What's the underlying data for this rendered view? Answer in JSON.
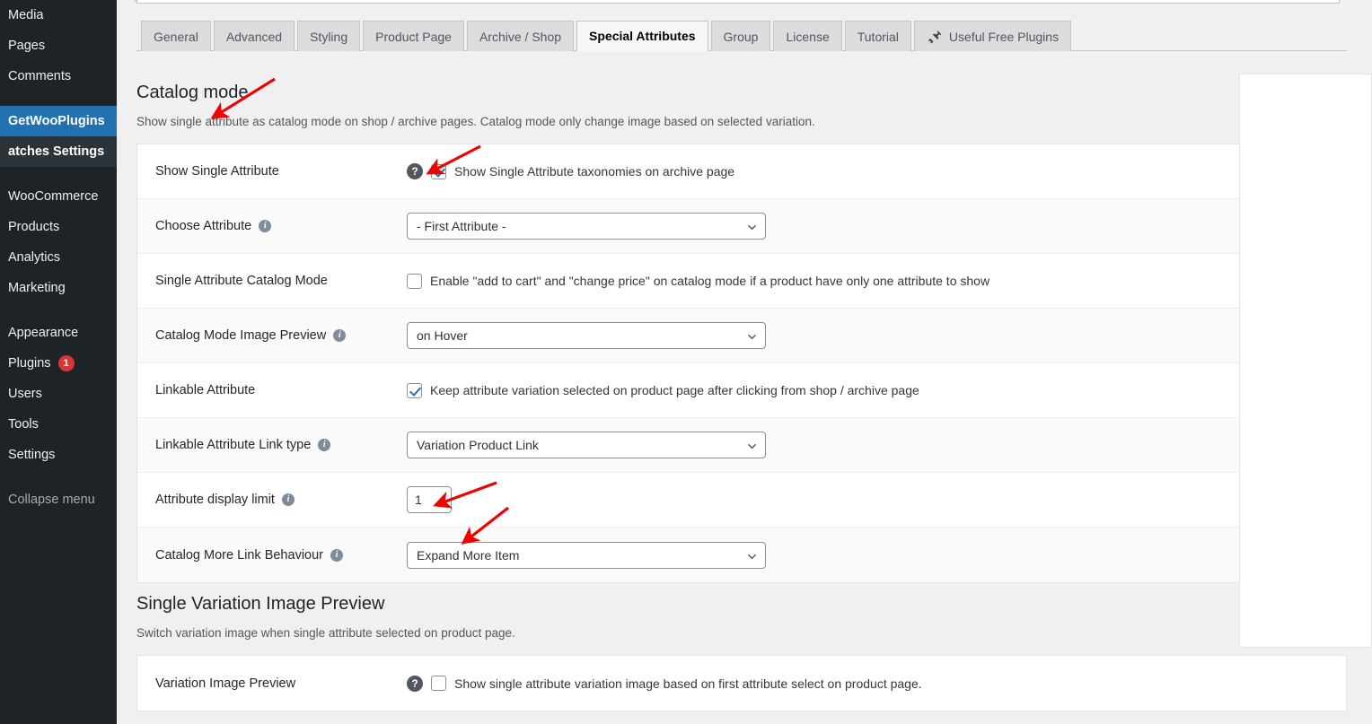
{
  "sidebar": {
    "items": [
      {
        "label": "Media",
        "icon": "media-icon",
        "current": false,
        "badge": null
      },
      {
        "label": "Pages",
        "icon": "pages-icon",
        "current": false,
        "badge": null
      },
      {
        "label": "Comments",
        "icon": "comments-icon",
        "current": false,
        "badge": null
      },
      {
        "label": "GetWooPlugins",
        "icon": "getwooplugins-icon",
        "current": true,
        "badge": null
      },
      {
        "label": "WooCommerce",
        "icon": "woocommerce-icon",
        "current": false,
        "badge": null
      },
      {
        "label": "Products",
        "icon": "products-icon",
        "current": false,
        "badge": null
      },
      {
        "label": "Analytics",
        "icon": "analytics-icon",
        "current": false,
        "badge": null
      },
      {
        "label": "Marketing",
        "icon": "marketing-icon",
        "current": false,
        "badge": null
      },
      {
        "label": "Appearance",
        "icon": "appearance-icon",
        "current": false,
        "badge": null
      },
      {
        "label": "Plugins",
        "icon": "plugins-icon",
        "current": false,
        "badge": "1"
      },
      {
        "label": "Users",
        "icon": "users-icon",
        "current": false,
        "badge": null
      },
      {
        "label": "Tools",
        "icon": "tools-icon",
        "current": false,
        "badge": null
      },
      {
        "label": "Settings",
        "icon": "settings-icon",
        "current": false,
        "badge": null
      }
    ],
    "submenu_label": "atches Settings",
    "collapse_label": "Collapse menu"
  },
  "tabs": [
    {
      "label": "General",
      "active": false,
      "icon": null
    },
    {
      "label": "Advanced",
      "active": false,
      "icon": null
    },
    {
      "label": "Styling",
      "active": false,
      "icon": null
    },
    {
      "label": "Product Page",
      "active": false,
      "icon": null
    },
    {
      "label": "Archive / Shop",
      "active": false,
      "icon": null
    },
    {
      "label": "Special Attributes",
      "active": true,
      "icon": null
    },
    {
      "label": "Group",
      "active": false,
      "icon": null
    },
    {
      "label": "License",
      "active": false,
      "icon": null
    },
    {
      "label": "Tutorial",
      "active": false,
      "icon": null
    },
    {
      "label": "Useful Free Plugins",
      "active": false,
      "icon": "plug-icon"
    }
  ],
  "catalog_mode": {
    "title": "Catalog mode",
    "description": "Show single attribute as catalog mode on shop / archive pages. Catalog mode only change image based on selected variation.",
    "rows": {
      "show_single_attribute": {
        "label": "Show Single Attribute",
        "help": "?",
        "checkbox_label": "Show Single Attribute taxonomies on archive page",
        "checked": true
      },
      "choose_attribute": {
        "label": "Choose Attribute",
        "info": "i",
        "value": "- First Attribute -",
        "options": [
          "- First Attribute -"
        ]
      },
      "single_attribute_catalog_mode": {
        "label": "Single Attribute Catalog Mode",
        "checkbox_label": "Enable \"add to cart\" and \"change price\" on catalog mode if a product have only one attribute to show",
        "checked": false
      },
      "catalog_mode_image_preview": {
        "label": "Catalog Mode Image Preview",
        "info": "i",
        "value": "on Hover",
        "options": [
          "on Hover"
        ]
      },
      "linkable_attribute": {
        "label": "Linkable Attribute",
        "checkbox_label": "Keep attribute variation selected on product page after clicking from shop / archive page",
        "checked": true
      },
      "linkable_attribute_link_type": {
        "label": "Linkable Attribute Link type",
        "info": "i",
        "value": "Variation Product Link",
        "options": [
          "Variation Product Link"
        ]
      },
      "attribute_display_limit": {
        "label": "Attribute display limit",
        "info": "i",
        "value": "1"
      },
      "catalog_more_link_behaviour": {
        "label": "Catalog More Link Behaviour",
        "info": "i",
        "value": "Expand More Item",
        "options": [
          "Expand More Item"
        ]
      }
    }
  },
  "single_variation_image_preview": {
    "title": "Single Variation Image Preview",
    "description": "Switch variation image when single attribute selected on product page.",
    "rows": {
      "variation_image_preview": {
        "label": "Variation Image Preview",
        "help": "?",
        "checkbox_label": "Show single attribute variation image based on first attribute select on product page.",
        "checked": false
      }
    }
  },
  "colors": {
    "sidebar_bg": "#1d2327",
    "sidebar_current": "#2271b1",
    "badge": "#d63638",
    "checkbox_accent": "#2271b1",
    "annotation_arrow": "#f20000",
    "page_bg": "#f0f0f1",
    "panel_bg": "#ffffff"
  },
  "annotations": {
    "arrow_color": "#f20000",
    "arrows": [
      {
        "name": "arrow-to-catalog-mode-title",
        "points_to": "Catalog mode"
      },
      {
        "name": "arrow-to-show-single-attribute-checkbox",
        "points_to": "Show Single Attribute checkbox"
      },
      {
        "name": "arrow-to-attribute-display-limit-input",
        "points_to": "Attribute display limit input"
      },
      {
        "name": "arrow-to-catalog-more-link-behaviour-select",
        "points_to": "Catalog More Link Behaviour select"
      }
    ]
  }
}
